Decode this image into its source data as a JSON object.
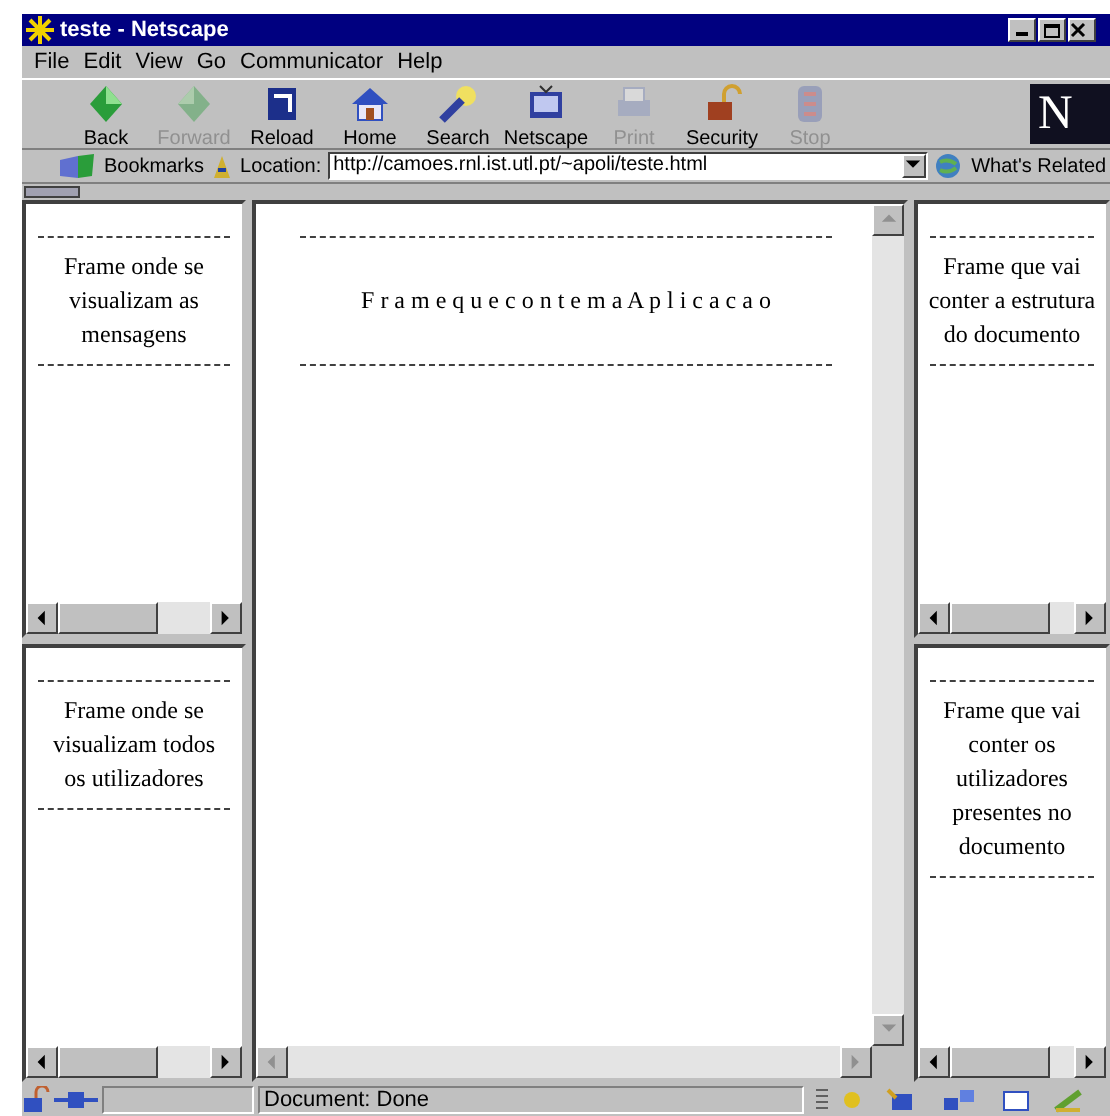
{
  "window": {
    "title": "teste - Netscape"
  },
  "menu": [
    "File",
    "Edit",
    "View",
    "Go",
    "Communicator",
    "Help"
  ],
  "toolbar": [
    {
      "label": "Back",
      "kind": "back",
      "disabled": false
    },
    {
      "label": "Forward",
      "kind": "forward",
      "disabled": true
    },
    {
      "label": "Reload",
      "kind": "reload",
      "disabled": false
    },
    {
      "label": "Home",
      "kind": "home",
      "disabled": false
    },
    {
      "label": "Search",
      "kind": "search",
      "disabled": false
    },
    {
      "label": "Netscape",
      "kind": "netscape",
      "disabled": false
    },
    {
      "label": "Print",
      "kind": "print",
      "disabled": true
    },
    {
      "label": "Security",
      "kind": "security",
      "disabled": false
    },
    {
      "label": "Stop",
      "kind": "stop",
      "disabled": true
    }
  ],
  "logo": "N",
  "location_bar": {
    "bookmarks": "Bookmarks",
    "label": "Location:",
    "url": "http://camoes.rnl.ist.utl.pt/~apoli/teste.html",
    "related": "What's Related"
  },
  "frames": {
    "left_top": {
      "text": "Frame onde se\nvisualizam as\nmensagens"
    },
    "left_bottom": {
      "text": "Frame onde se\nvisualizam todos\nos utilizadores"
    },
    "center": {
      "text": "F r a m e q u e c o n t e m a A p l i c a c a o"
    },
    "right_top": {
      "text": "Frame que vai\nconter a estrutura\ndo documento"
    },
    "right_bottom": {
      "text": "Frame que vai\nconter os\nutilizadores\npresentes no\ndocumento"
    }
  },
  "status_bar": {
    "text": "Document: Done"
  }
}
